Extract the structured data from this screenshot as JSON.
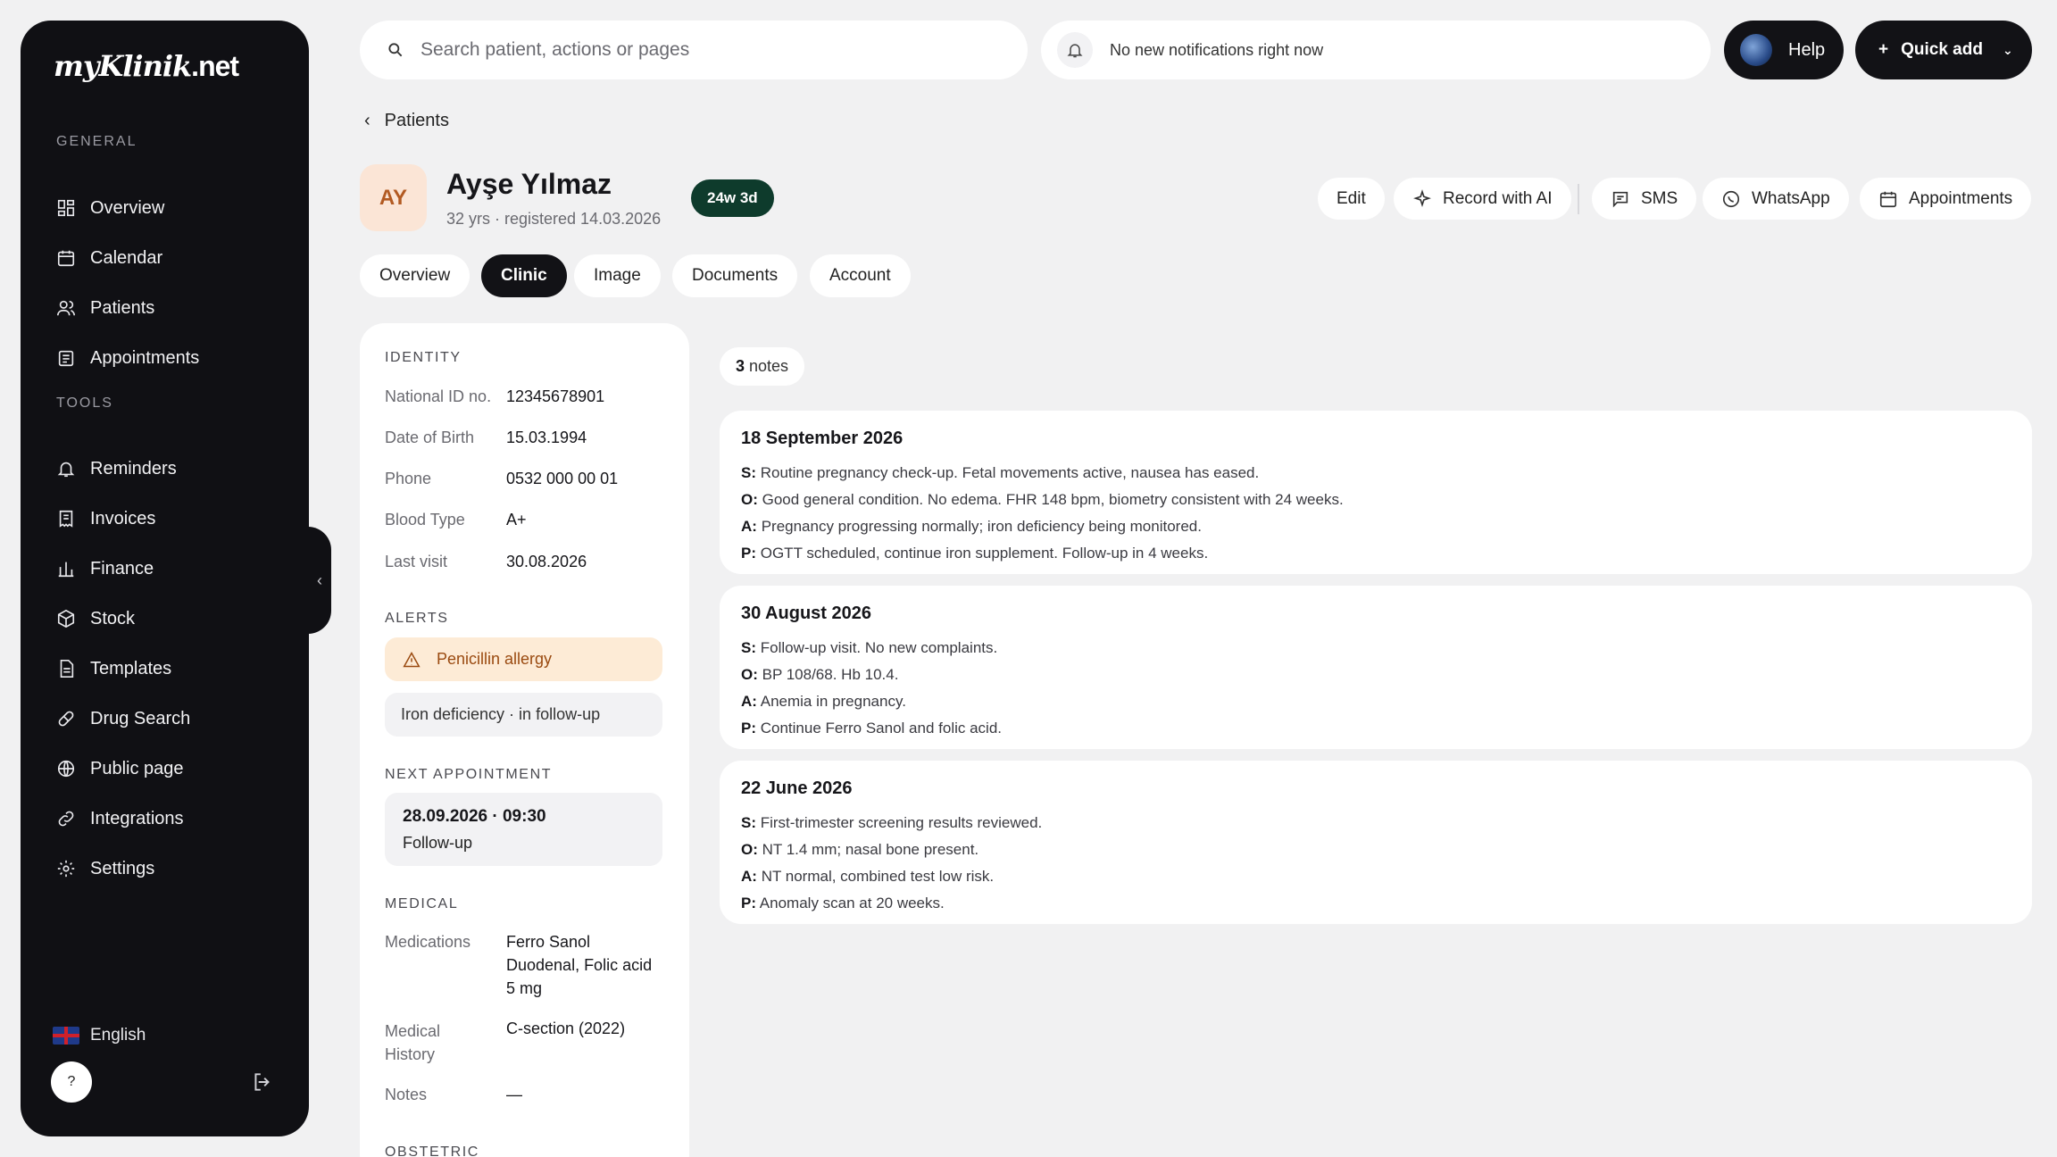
{
  "brand": {
    "logo_script": "myKlinik",
    "logo_tld": ".net"
  },
  "sidebar": {
    "general_label": "GENERAL",
    "tools_label": "TOOLS",
    "general": [
      {
        "label": "Overview",
        "icon": "grid-icon"
      },
      {
        "label": "Calendar",
        "icon": "calendar-icon"
      },
      {
        "label": "Patients",
        "icon": "users-icon"
      },
      {
        "label": "Appointments",
        "icon": "clipboard-icon"
      }
    ],
    "tools": [
      {
        "label": "Reminders",
        "icon": "bell-icon"
      },
      {
        "label": "Invoices",
        "icon": "receipt-icon"
      },
      {
        "label": "Finance",
        "icon": "bar-chart-icon"
      },
      {
        "label": "Stock",
        "icon": "box-icon"
      },
      {
        "label": "Templates",
        "icon": "document-icon"
      },
      {
        "label": "Drug Search",
        "icon": "pill-icon"
      },
      {
        "label": "Public page",
        "icon": "globe-icon"
      },
      {
        "label": "Integrations",
        "icon": "link-icon"
      },
      {
        "label": "Settings",
        "icon": "gear-icon"
      }
    ],
    "language": "English",
    "help_label": "?"
  },
  "topbar": {
    "search_placeholder": "Search patient, actions or pages",
    "notification_text": "No new notifications right now",
    "help_label": "Help",
    "quick_add_label": "Quick add"
  },
  "breadcrumb": {
    "back_label": "Patients"
  },
  "patient": {
    "initials": "AY",
    "name": "Ayşe Yılmaz",
    "meta": "32 yrs · registered 14.03.2026",
    "gestation_badge": "24w 3d"
  },
  "actions": {
    "edit": "Edit",
    "record_ai": "Record with AI",
    "sms": "SMS",
    "whatsapp": "WhatsApp",
    "appointments": "Appointments"
  },
  "tabs": [
    "Overview",
    "Clinic",
    "Image",
    "Documents",
    "Account"
  ],
  "active_tab": "Clinic",
  "identity": {
    "title": "IDENTITY",
    "rows": [
      {
        "label": "National ID no.",
        "value": "12345678901"
      },
      {
        "label": "Date of Birth",
        "value": "15.03.1994"
      },
      {
        "label": "Phone",
        "value": "0532 000 00 01"
      },
      {
        "label": "Blood Type",
        "value": "A+"
      },
      {
        "label": "Last visit",
        "value": "30.08.2026"
      }
    ]
  },
  "alerts": {
    "title": "ALERTS",
    "items": [
      "Penicillin allergy",
      "Iron deficiency · in follow-up"
    ]
  },
  "next_appointment": {
    "title": "NEXT APPOINTMENT",
    "datetime": "28.09.2026 · 09:30",
    "type": "Follow-up"
  },
  "medical": {
    "title": "MEDICAL",
    "medications_label": "Medications",
    "medications_value": "Ferro Sanol Duodenal, Folic acid 5 mg",
    "history_label": "Medical History",
    "history_value": "C-section (2022)",
    "notes_label": "Notes",
    "notes_value": "—"
  },
  "obstetric_title": "OBSTETRIC",
  "notes": {
    "count": "3",
    "count_suffix": "notes",
    "items": [
      {
        "date": "18 September 2026",
        "s": "Routine pregnancy check-up. Fetal movements active, nausea has eased.",
        "o": "Good general condition. No edema. FHR 148 bpm, biometry consistent with 24 weeks.",
        "a": "Pregnancy progressing normally; iron deficiency being monitored.",
        "p": "OGTT scheduled, continue iron supplement. Follow-up in 4 weeks."
      },
      {
        "date": "30 August 2026",
        "s": "Follow-up visit. No new complaints.",
        "o": "BP 108/68. Hb 10.4.",
        "a": "Anemia in pregnancy.",
        "p": "Continue Ferro Sanol and folic acid."
      },
      {
        "date": "22 June 2026",
        "s": "First-trimester screening results reviewed.",
        "o": "NT 1.4 mm; nasal bone present.",
        "a": "NT normal, combined test low risk.",
        "p": "Anomaly scan at 20 weeks."
      }
    ]
  },
  "soap_labels": {
    "s": "S:",
    "o": "O:",
    "a": "A:",
    "p": "P:"
  }
}
